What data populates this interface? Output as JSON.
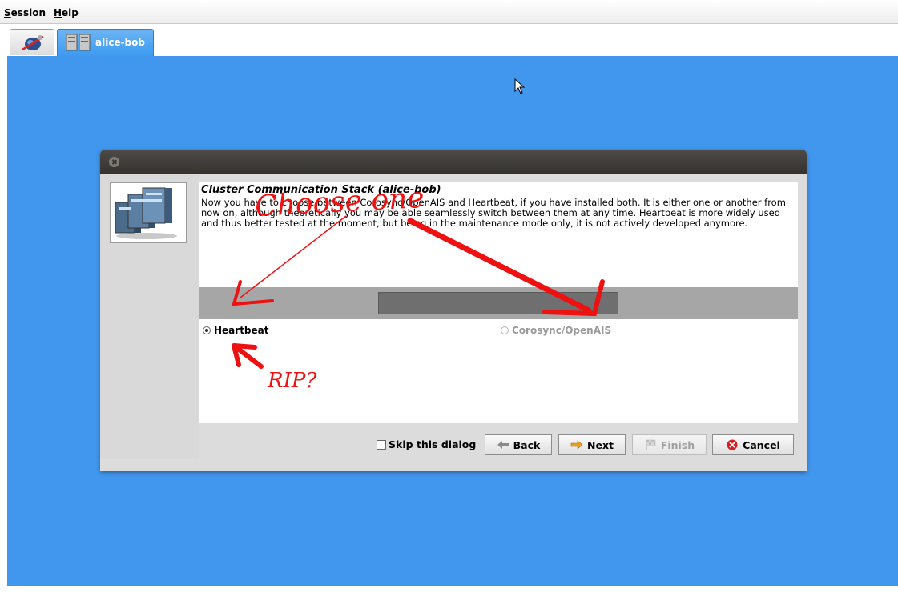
{
  "menubar": {
    "session": {
      "mnemonic": "S",
      "rest": "ession"
    },
    "help": {
      "mnemonic": "H",
      "rest": "elp"
    }
  },
  "tabs": {
    "home_icon": "network-globe-icon",
    "cluster_label": "alice-bob",
    "cluster_icon": "servers-icon"
  },
  "dialog": {
    "heading": "Cluster Communication Stack (alice-bob)",
    "description": "Now you have to choose between Corosync/OpenAIS and Heartbeat, if you have installed both. It is either one or another from now on, although theoretically you may be able seamlessly switch between them at any time. Heartbeat is more widely used and thus better tested at the moment, but being in the maintenance mode only, it is not actively developed anymore.",
    "options": [
      {
        "label": "Heartbeat",
        "selected": true,
        "enabled": true
      },
      {
        "label": "Corosync/OpenAIS",
        "selected": false,
        "enabled": false
      }
    ],
    "skip_label": "Skip this dialog",
    "skip_checked": false,
    "buttons": {
      "back": "Back",
      "next": "Next",
      "finish": "Finish",
      "cancel": "Cancel"
    }
  },
  "annotations": {
    "choose": "Choose one",
    "rip": "RIP?",
    "color": "#ee1111"
  },
  "colors": {
    "desktop": "#4197ee",
    "tab_active": "#3d9bf0",
    "titlebar": "#3b3835"
  }
}
